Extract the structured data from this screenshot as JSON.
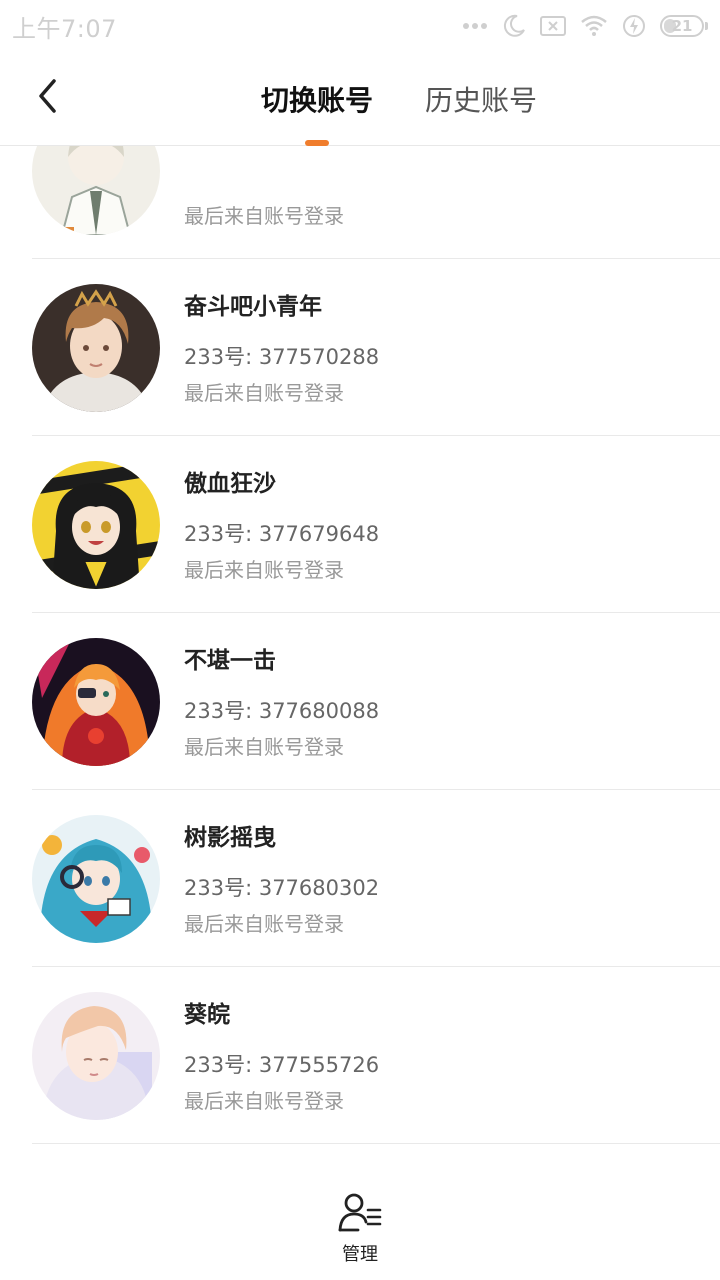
{
  "status_bar": {
    "time": "上午7:07",
    "battery_level": "21",
    "icons": [
      "more-dots-icon",
      "moon-icon",
      "sim-off-icon",
      "wifi-icon",
      "charging-icon",
      "battery-icon"
    ]
  },
  "header": {
    "back_icon": "chevron-left-icon",
    "tabs": [
      {
        "label": "切换账号",
        "active": true
      },
      {
        "label": "历史账号",
        "active": false
      }
    ],
    "accent_color": "#f07d2c"
  },
  "accounts": [
    {
      "name": "",
      "id_text": "",
      "note": "最后来自账号登录",
      "avatar": "avatar-1-partial"
    },
    {
      "name": "奋斗吧小青年",
      "id_text": "233号: 377570288",
      "note": "最后来自账号登录",
      "avatar": "avatar-2"
    },
    {
      "name": "傲血狂沙",
      "id_text": "233号: 377679648",
      "note": "最后来自账号登录",
      "avatar": "avatar-3"
    },
    {
      "name": "不堪一击",
      "id_text": "233号: 377680088",
      "note": "最后来自账号登录",
      "avatar": "avatar-4"
    },
    {
      "name": "树影摇曳",
      "id_text": "233号: 377680302",
      "note": "最后来自账号登录",
      "avatar": "avatar-5"
    },
    {
      "name": "葵皖",
      "id_text": "233号: 377555726",
      "note": "最后来自账号登录",
      "avatar": "avatar-6"
    }
  ],
  "bottom_bar": {
    "manage_label": "管理",
    "manage_icon": "user-list-icon"
  }
}
